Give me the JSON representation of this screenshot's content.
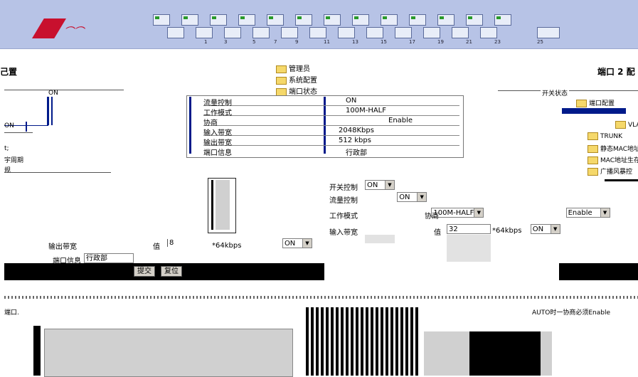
{
  "menu": {
    "items": [
      {
        "label": "管理员"
      },
      {
        "label": "系统配置"
      },
      {
        "label": "端口状态"
      }
    ]
  },
  "page": {
    "left_title": "己置",
    "right_title": "端口 2 配"
  },
  "port_numbers": [
    "1",
    "3",
    "5",
    "7",
    "9",
    "11",
    "13",
    "15",
    "17",
    "19",
    "21",
    "23",
    "25"
  ],
  "left_diagram": {
    "on_label": "ON",
    "labels": [
      "ON",
      "t;",
      "宇周期",
      "规"
    ]
  },
  "info_table": {
    "rows": [
      {
        "key": "流量控制",
        "value": "ON"
      },
      {
        "key": "工作模式",
        "value": "100M-HALF"
      },
      {
        "key": "协商",
        "value": "Enable"
      },
      {
        "key": "输入带宽",
        "value": "2048Kbps"
      },
      {
        "key": "输出带宽",
        "value": "512 kbps"
      },
      {
        "key": "端口信息",
        "value": "行政部"
      }
    ]
  },
  "right_tree": {
    "header": "开关状态",
    "items": [
      {
        "label": "端口配置"
      },
      {
        "label": "VLA"
      },
      {
        "label": "TRUNK"
      },
      {
        "label": "静态MAC地址"
      },
      {
        "label": "MAC地址生存"
      },
      {
        "label": "广播风暴控"
      }
    ]
  },
  "form": {
    "switch_label": "开关控制",
    "switch_value": "ON",
    "flow_label": "流量控制",
    "flow_value": "ON",
    "mode_label": "工作模式",
    "mode_value": "100M-HALF",
    "negotiate_label": "协商",
    "negotiate_value": "Enable",
    "in_bw_label": "输入带宽",
    "in_bw_value": "ON",
    "in_value_label": "值",
    "in_value": "32",
    "in_unit": "*64kbps",
    "out_bw_label": "输出带宽",
    "out_bw_value": "ON",
    "out_value_label": "值",
    "out_value": "8",
    "out_unit": "*64kbps",
    "port_info_label": "端口信息",
    "port_info_value": "行政部",
    "submit_label": "提交",
    "reset_label": "复位"
  },
  "notes": {
    "left_note": "端口.",
    "right_note": "AUTO时一协商必须Enable"
  },
  "colors": {
    "header_bg": "#b7c3e6",
    "accent": "#001a8a",
    "logo": "#c8102e"
  }
}
